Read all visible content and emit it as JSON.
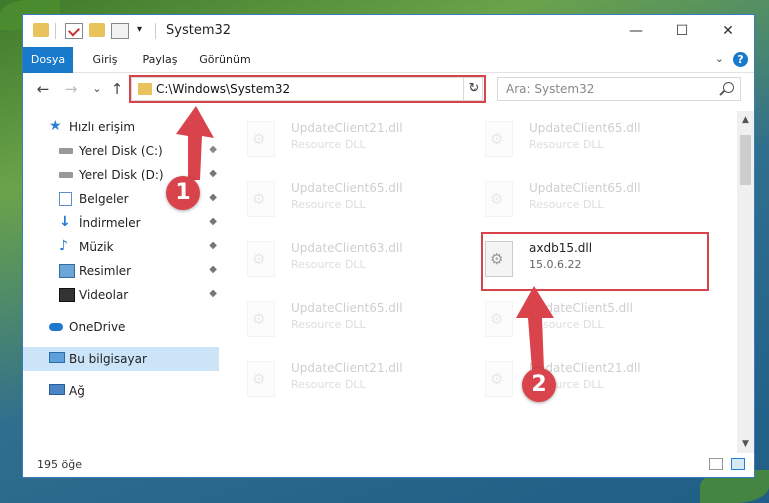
{
  "window": {
    "title": "System32",
    "controls": {
      "minimize": "—",
      "maximize": "☐",
      "close": "✕"
    }
  },
  "ribbon": {
    "tabs": [
      "Dosya",
      "Giriş",
      "Paylaş",
      "Görünüm"
    ],
    "help": "?"
  },
  "nav": {
    "back": "←",
    "forward": "→",
    "recent": "⌄",
    "up": "↑",
    "address": "C:\\Windows\\System32",
    "address_dropdown": "⌄",
    "refresh": "↻",
    "search_placeholder": "Ara: System32"
  },
  "sidebar": {
    "items": [
      {
        "label": "Hızlı erişim",
        "icon": "star-icon",
        "pinned": false
      },
      {
        "label": "Yerel Disk (C:)",
        "icon": "drive-icon",
        "pinned": true
      },
      {
        "label": "Yerel Disk (D:)",
        "icon": "drive-icon",
        "pinned": true
      },
      {
        "label": "Belgeler",
        "icon": "documents-icon",
        "pinned": true
      },
      {
        "label": "İndirmeler",
        "icon": "download-icon",
        "pinned": true
      },
      {
        "label": "Müzik",
        "icon": "music-icon",
        "pinned": true
      },
      {
        "label": "Resimler",
        "icon": "pictures-icon",
        "pinned": true
      },
      {
        "label": "Videolar",
        "icon": "videos-icon",
        "pinned": true
      },
      {
        "label": "OneDrive",
        "icon": "cloud-icon",
        "pinned": false
      },
      {
        "label": "Bu bilgisayar",
        "icon": "computer-icon",
        "pinned": false
      },
      {
        "label": "Ağ",
        "icon": "network-icon",
        "pinned": false
      }
    ],
    "pin_glyph": "📌"
  },
  "files": [
    {
      "name": "UpdateClient21.dll",
      "type": "Resource DLL"
    },
    {
      "name": "UpdateClient65.dll",
      "type": "Resource DLL"
    },
    {
      "name": "UpdateClient65.dll",
      "type": "Resource DLL"
    },
    {
      "name": "UpdateClient65.dll",
      "type": "Resource DLL"
    },
    {
      "name": "UpdateClient63.dll",
      "type": "Resource DLL"
    },
    {
      "name": "axdb15.dll",
      "type": "15.0.6.22"
    },
    {
      "name": "UpdateClient65.dll",
      "type": "Resource DLL"
    },
    {
      "name": "UpdateClient5.dll",
      "type": "Resource DLL"
    },
    {
      "name": "UpdateClient21.dll",
      "type": "Resource DLL"
    },
    {
      "name": "UpdateClient21.dll",
      "type": "Resource DLL"
    }
  ],
  "status": {
    "item_count": "195 öğe"
  },
  "callouts": {
    "one": "1",
    "two": "2"
  },
  "colors": {
    "accent": "#1979ca",
    "highlight": "#d9434b",
    "selection": "#cce4f7"
  }
}
